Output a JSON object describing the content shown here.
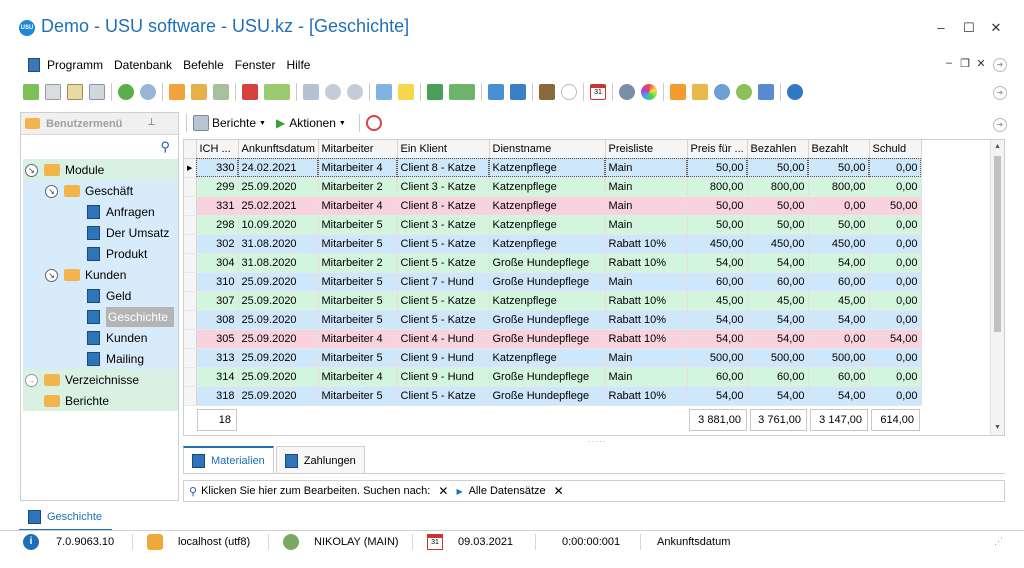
{
  "window": {
    "title": "Demo - USU software - USU.kz - [Geschichte]",
    "logo_text": "USU"
  },
  "menu": [
    "Programm",
    "Datenbank",
    "Befehle",
    "Fenster",
    "Hilfe"
  ],
  "sidebar": {
    "title": "Benutzermenü",
    "items": [
      {
        "label": "Module",
        "level": 0,
        "kind": "folder",
        "toggle": "open"
      },
      {
        "label": "Geschäft",
        "level": 1,
        "kind": "folder",
        "toggle": "open"
      },
      {
        "label": "Anfragen",
        "level": 2,
        "kind": "doc"
      },
      {
        "label": "Der Umsatz",
        "level": 2,
        "kind": "doc"
      },
      {
        "label": "Produkt",
        "level": 2,
        "kind": "doc"
      },
      {
        "label": "Kunden",
        "level": 1,
        "kind": "folder",
        "toggle": "open"
      },
      {
        "label": "Geld",
        "level": 2,
        "kind": "doc"
      },
      {
        "label": "Geschichte",
        "level": 2,
        "kind": "doc",
        "selected": true
      },
      {
        "label": "Kunden",
        "level": 2,
        "kind": "doc"
      },
      {
        "label": "Mailing",
        "level": 2,
        "kind": "doc"
      },
      {
        "label": "Verzeichnisse",
        "level": 0,
        "kind": "folder",
        "toggle": "closed"
      },
      {
        "label": "Berichte",
        "level": 0,
        "kind": "folder",
        "toggle": "none"
      }
    ]
  },
  "content_toolbar": {
    "reports": "Berichte",
    "actions": "Aktionen"
  },
  "grid": {
    "columns": [
      "ICH ...",
      "Ankunftsdatum",
      "Mitarbeiter",
      "Ein Klient",
      "Dienstname",
      "Preisliste",
      "Preis für ...",
      "Bezahlen",
      "Bezahlt",
      "Schuld"
    ],
    "rows": [
      {
        "color": "blue",
        "focused": true,
        "cells": [
          "330",
          "24.02.2021",
          "Mitarbeiter 4",
          "Client 8 - Katze",
          "Katzenpflege",
          "Main",
          "50,00",
          "50,00",
          "50,00",
          "0,00"
        ]
      },
      {
        "color": "green",
        "cells": [
          "299",
          "25.09.2020",
          "Mitarbeiter 2",
          "Client 3 - Katze",
          "Katzenpflege",
          "Main",
          "800,00",
          "800,00",
          "800,00",
          "0,00"
        ]
      },
      {
        "color": "red",
        "cells": [
          "331",
          "25.02.2021",
          "Mitarbeiter 4",
          "Client 8 - Katze",
          "Katzenpflege",
          "Main",
          "50,00",
          "50,00",
          "0,00",
          "50,00"
        ]
      },
      {
        "color": "green",
        "cells": [
          "298",
          "10.09.2020",
          "Mitarbeiter 5",
          "Client 3 - Katze",
          "Katzenpflege",
          "Main",
          "50,00",
          "50,00",
          "50,00",
          "0,00"
        ]
      },
      {
        "color": "blue",
        "cells": [
          "302",
          "31.08.2020",
          "Mitarbeiter 5",
          "Client 5 - Katze",
          "Katzenpflege",
          "Rabatt 10%",
          "450,00",
          "450,00",
          "450,00",
          "0,00"
        ]
      },
      {
        "color": "green",
        "cells": [
          "304",
          "31.08.2020",
          "Mitarbeiter 2",
          "Client 5 - Katze",
          "Große Hundepflege",
          "Rabatt 10%",
          "54,00",
          "54,00",
          "54,00",
          "0,00"
        ]
      },
      {
        "color": "blue",
        "cells": [
          "310",
          "25.09.2020",
          "Mitarbeiter 5",
          "Client 7 - Hund",
          "Große Hundepflege",
          "Main",
          "60,00",
          "60,00",
          "60,00",
          "0,00"
        ]
      },
      {
        "color": "green",
        "cells": [
          "307",
          "25.09.2020",
          "Mitarbeiter 5",
          "Client 5 - Katze",
          "Katzenpflege",
          "Rabatt 10%",
          "45,00",
          "45,00",
          "45,00",
          "0,00"
        ]
      },
      {
        "color": "blue",
        "cells": [
          "308",
          "25.09.2020",
          "Mitarbeiter 5",
          "Client 5 - Katze",
          "Große Hundepflege",
          "Rabatt 10%",
          "54,00",
          "54,00",
          "54,00",
          "0,00"
        ]
      },
      {
        "color": "red",
        "cells": [
          "305",
          "25.09.2020",
          "Mitarbeiter 4",
          "Client 4 - Hund",
          "Große Hundepflege",
          "Rabatt 10%",
          "54,00",
          "54,00",
          "0,00",
          "54,00"
        ]
      },
      {
        "color": "blue",
        "cells": [
          "313",
          "25.09.2020",
          "Mitarbeiter 5",
          "Client 9 - Hund",
          "Katzenpflege",
          "Main",
          "500,00",
          "500,00",
          "500,00",
          "0,00"
        ]
      },
      {
        "color": "green",
        "cells": [
          "314",
          "25.09.2020",
          "Mitarbeiter 4",
          "Client 9 - Hund",
          "Große Hundepflege",
          "Main",
          "60,00",
          "60,00",
          "60,00",
          "0,00"
        ]
      },
      {
        "color": "blue",
        "cells": [
          "318",
          "25.09.2020",
          "Mitarbeiter 5",
          "Client 5 - Katze",
          "Große Hundepflege",
          "Rabatt 10%",
          "54,00",
          "54,00",
          "54,00",
          "0,00"
        ]
      }
    ],
    "footer": {
      "count": "18",
      "price_total": "3 881,00",
      "pay_total": "3 761,00",
      "paid_total": "3 147,00",
      "debt_total": "614,00"
    }
  },
  "bottom_tabs": [
    "Materialien",
    "Zahlungen"
  ],
  "filter": {
    "hint": "Klicken Sie hier zum Bearbeiten. Suchen nach:",
    "all_records": "Alle Datensätze"
  },
  "window_tab": "Geschichte",
  "status": {
    "version": "7.0.9063.10",
    "server": "localhost (utf8)",
    "user": "NIKOLAY (MAIN)",
    "date": "09.03.2021",
    "timer": "0:00:00:001",
    "sort_field": "Ankunftsdatum",
    "calendar_day": "31"
  },
  "colors": {
    "accent": "#1f6fb8",
    "row_blue": "#cfe7fb",
    "row_green": "#d3f5de",
    "row_red": "#f8d3dd",
    "selected": "#b4b4b4"
  }
}
